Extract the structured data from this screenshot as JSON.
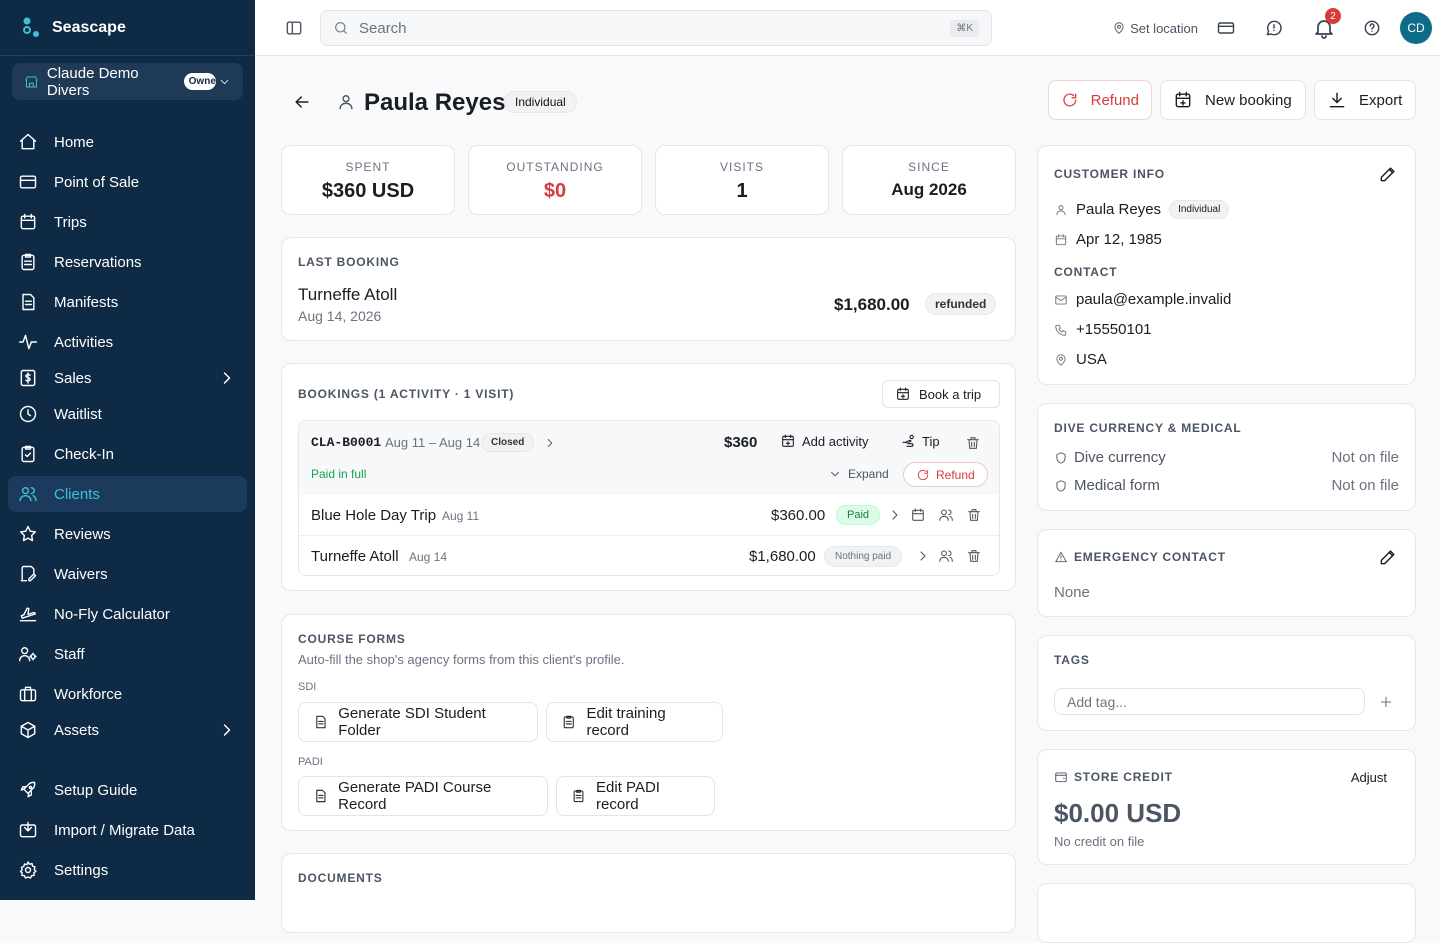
{
  "app": {
    "name": "Seascape",
    "org_name": "Claude Demo Divers",
    "org_badge": "Owner"
  },
  "sidebar": {
    "items": [
      {
        "label": "Home",
        "icon": "home-icon"
      },
      {
        "label": "Point of Sale",
        "icon": "card-icon"
      },
      {
        "label": "Trips",
        "icon": "calendar-icon"
      },
      {
        "label": "Reservations",
        "icon": "clipboard-icon"
      },
      {
        "label": "Manifests",
        "icon": "document-icon"
      },
      {
        "label": "Activities",
        "icon": "activity-icon"
      },
      {
        "label": "Sales",
        "icon": "dollar-icon"
      },
      {
        "label": "Waitlist",
        "icon": "clock-icon"
      },
      {
        "label": "Check-In",
        "icon": "clipboard-check-icon"
      },
      {
        "label": "Clients",
        "icon": "users-icon"
      },
      {
        "label": "Reviews",
        "icon": "star-icon"
      },
      {
        "label": "Waivers",
        "icon": "pen-icon"
      },
      {
        "label": "No-Fly Calculator",
        "icon": "plane-icon"
      },
      {
        "label": "Staff",
        "icon": "staff-icon"
      },
      {
        "label": "Workforce",
        "icon": "briefcase-icon"
      },
      {
        "label": "Assets",
        "icon": "box-icon"
      },
      {
        "label": "Setup Guide",
        "icon": "rocket-icon"
      },
      {
        "label": "Import / Migrate Data",
        "icon": "import-icon"
      },
      {
        "label": "Settings",
        "icon": "gear-icon"
      }
    ],
    "active": "Clients"
  },
  "topbar": {
    "search_placeholder": "Search",
    "search_shortcut": "⌘K",
    "set_location": "Set location",
    "notification_count": "2",
    "user_initials": "CD"
  },
  "header": {
    "client_name": "Paula Reyes",
    "client_type": "Individual",
    "refund_label": "Refund",
    "new_booking_label": "New booking",
    "export_label": "Export"
  },
  "stats": [
    {
      "label": "SPENT",
      "value": "$360 USD"
    },
    {
      "label": "OUTSTANDING",
      "value": "$0"
    },
    {
      "label": "VISITS",
      "value": "1"
    },
    {
      "label": "SINCE",
      "value": "Aug 2026"
    }
  ],
  "last_booking": {
    "title": "LAST BOOKING",
    "name": "Turneffe Atoll",
    "date": "Aug 14, 2026",
    "amount": "$1,680.00",
    "status": "refunded"
  },
  "bookings": {
    "title": "BOOKINGS (1 ACTIVITY · 1 VISIT)",
    "book_trip_label": "Book a trip",
    "booking": {
      "code": "CLA-B0001",
      "dates": "Aug 11 – Aug 14",
      "status": "Closed",
      "total": "$360",
      "add_activity_label": "Add activity",
      "tip_label": "Tip",
      "payment_status": "Paid in full",
      "expand_label": "Expand",
      "refund_label": "Refund"
    },
    "trips": [
      {
        "name": "Blue Hole Day Trip",
        "date": "Aug 11",
        "amount": "$360.00",
        "status": "Paid"
      },
      {
        "name": "Turneffe Atoll",
        "date": "Aug 14",
        "amount": "$1,680.00",
        "status": "Nothing paid"
      }
    ]
  },
  "course_forms": {
    "title": "COURSE FORMS",
    "subtitle": "Auto-fill the shop's agency forms from this client's profile.",
    "sdi_label": "SDI",
    "sdi_generate": "Generate SDI Student Folder",
    "sdi_edit": "Edit training record",
    "padi_label": "PADI",
    "padi_generate": "Generate PADI Course Record",
    "padi_edit": "Edit PADI record"
  },
  "documents": {
    "title": "DOCUMENTS"
  },
  "customer_info": {
    "title": "CUSTOMER INFO",
    "name": "Paula Reyes",
    "type": "Individual",
    "dob": "Apr 12, 1985",
    "contact_title": "CONTACT",
    "email": "paula@example.invalid",
    "phone": "+15550101",
    "country": "USA"
  },
  "dive_medical": {
    "title": "DIVE CURRENCY & MEDICAL",
    "currency_label": "Dive currency",
    "currency_value": "Not on file",
    "medical_label": "Medical form",
    "medical_value": "Not on file"
  },
  "emergency": {
    "title": "EMERGENCY CONTACT",
    "value": "None"
  },
  "tags": {
    "title": "TAGS",
    "placeholder": "Add tag..."
  },
  "store_credit": {
    "title": "STORE CREDIT",
    "adjust_label": "Adjust",
    "amount": "$0.00 USD",
    "note": "No credit on file"
  },
  "colors": {
    "sidebar_bg": "#0f2a44",
    "accent": "#3bc0d8",
    "danger": "#d93a3a",
    "success": "#16a34a"
  }
}
